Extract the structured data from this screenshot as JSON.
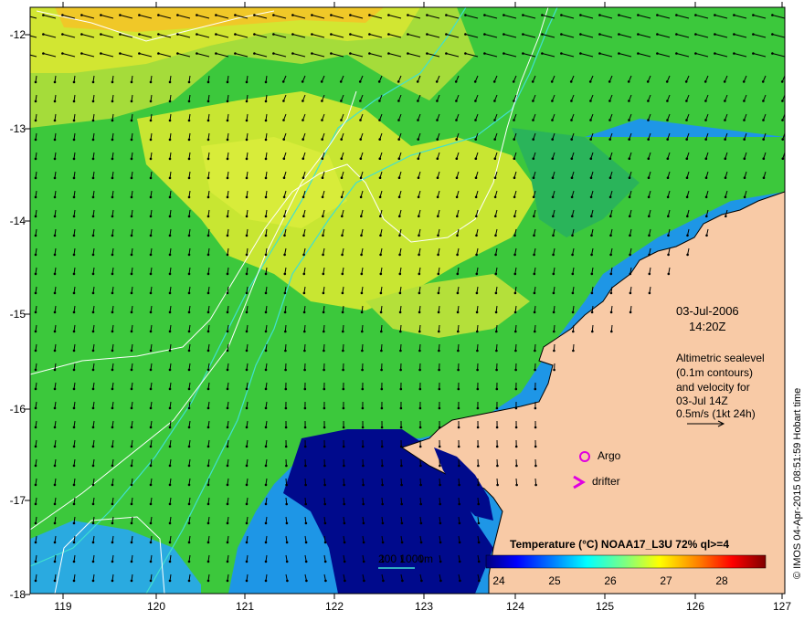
{
  "map": {
    "lon_ticks": [
      "119",
      "120",
      "121",
      "122",
      "123",
      "124",
      "125",
      "126",
      "127"
    ],
    "lat_ticks": [
      "-12",
      "-13",
      "-14",
      "-15",
      "-16",
      "-17",
      "-18"
    ],
    "lon_range": [
      118.6,
      127.0
    ],
    "lat_range": [
      -11.8,
      -18.0
    ]
  },
  "annotation": {
    "date": "03-Jul-2006",
    "time": "14:20Z",
    "desc_lines": [
      "Altimetric sealevel",
      "(0.1m contours)",
      "and velocity for",
      "03-Jul 14Z",
      "0.5m/s (1kt 24h)"
    ]
  },
  "legend": {
    "argo_label": "Argo",
    "drifter_label": "drifter",
    "depth_label": "200  1000m"
  },
  "colorbar": {
    "title": "Temperature (°C) NOAA17_L3U 72% ql>=4",
    "ticks": [
      "24",
      "25",
      "26",
      "27",
      "28"
    ],
    "colors": [
      "#00007f",
      "#0000ff",
      "#007fff",
      "#00ffff",
      "#7fff7f",
      "#c8ff3c",
      "#ffff00",
      "#ff7f00",
      "#ff0000",
      "#7f0000"
    ]
  },
  "credit": "© IMOS 04-Apr-2015 08:51:59 Hobart time",
  "colors": {
    "land": "#f8caa6",
    "sst_main": "#3cc83c",
    "sst_warm": "#c8e632",
    "sst_cool": "#1e96e6",
    "sst_cold": "#000a8c",
    "contour": "#ffffff",
    "isobath": "#40e0d0",
    "argo": "#e000e0"
  }
}
